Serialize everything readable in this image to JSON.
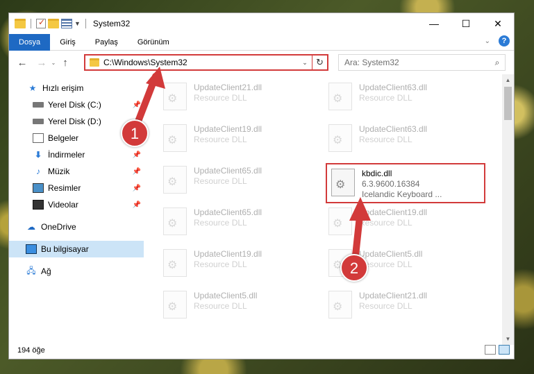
{
  "window": {
    "title": "System32",
    "buttons": {
      "minimize": "—",
      "maximize": "☐",
      "close": "✕"
    }
  },
  "ribbon": {
    "tabs": [
      "Dosya",
      "Giriş",
      "Paylaş",
      "Görünüm"
    ]
  },
  "nav": {
    "back": "←",
    "forward": "→",
    "recent": "⌄",
    "up": "↑",
    "address": "C:\\Windows\\System32",
    "refresh": "↻",
    "search_placeholder": "Ara: System32",
    "search_icon": "⌕"
  },
  "sidebar": {
    "items": [
      {
        "label": "Hızlı erişim"
      },
      {
        "label": "Yerel Disk (C:)"
      },
      {
        "label": "Yerel Disk (D:)"
      },
      {
        "label": "Belgeler"
      },
      {
        "label": "İndirmeler"
      },
      {
        "label": "Müzik"
      },
      {
        "label": "Resimler"
      },
      {
        "label": "Videolar"
      },
      {
        "label": "OneDrive"
      },
      {
        "label": "Bu bilgisayar"
      },
      {
        "label": "Ağ"
      }
    ]
  },
  "files": [
    {
      "name": "UpdateClient21.dll",
      "sub": "Resource DLL"
    },
    {
      "name": "UpdateClient63.dll",
      "sub": "Resource DLL"
    },
    {
      "name": "UpdateClient19.dll",
      "sub": "Resource DLL"
    },
    {
      "name": "UpdateClient63.dll",
      "sub": "Resource DLL"
    },
    {
      "name": "UpdateClient65.dll",
      "sub": "Resource DLL"
    },
    {
      "name": "kbdic.dll",
      "version": "6.3.9600.16384",
      "desc": "Icelandic Keyboard ..."
    },
    {
      "name": "UpdateClient65.dll",
      "sub": "Resource DLL"
    },
    {
      "name": "UpdateClient19.dll",
      "sub": "Resource DLL"
    },
    {
      "name": "UpdateClient19.dll",
      "sub": "Resource DLL"
    },
    {
      "name": "UpdateClient5.dll",
      "sub": "Resource DLL"
    },
    {
      "name": "UpdateClient5.dll",
      "sub": "Resource DLL"
    },
    {
      "name": "UpdateClient21.dll",
      "sub": "Resource DLL"
    }
  ],
  "status": {
    "count": "194 öğe"
  },
  "annotations": {
    "step1": "1",
    "step2": "2",
    "color": "#d23a3a"
  }
}
